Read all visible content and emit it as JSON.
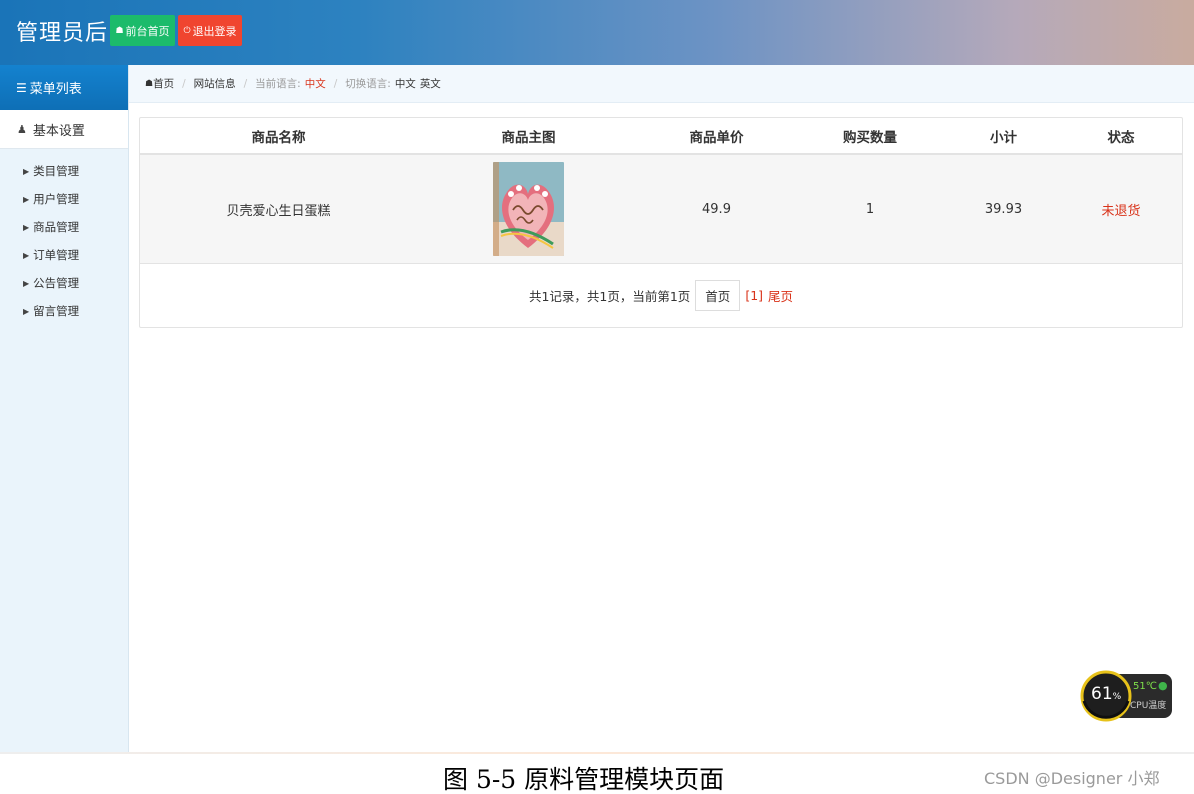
{
  "header": {
    "title": "管理员后台",
    "home_button": "前台首页",
    "logout_button": "退出登录"
  },
  "sidebar": {
    "menu_title": "菜单列表",
    "group_title": "基本设置",
    "items": [
      {
        "label": "类目管理"
      },
      {
        "label": "用户管理"
      },
      {
        "label": "商品管理"
      },
      {
        "label": "订单管理"
      },
      {
        "label": "公告管理"
      },
      {
        "label": "留言管理"
      }
    ]
  },
  "breadcrumb": {
    "home": "首页",
    "site_info": "网站信息",
    "current_lang_label": "当前语言:",
    "current_lang": "中文",
    "switch_lang_label": "切换语言:",
    "lang_zh": "中文",
    "lang_en": "英文"
  },
  "table": {
    "headers": [
      "商品名称",
      "商品主图",
      "商品单价",
      "购买数量",
      "小计",
      "状态"
    ],
    "rows": [
      {
        "name": "贝壳爱心生日蛋糕",
        "price": "49.9",
        "qty": "1",
        "subtotal": "39.93",
        "status": "未退货"
      }
    ]
  },
  "pagination": {
    "summary": "共1记录，共1页，当前第1页",
    "first": "首页",
    "current": "[1]",
    "last": "尾页"
  },
  "cpu": {
    "percent": "61",
    "percent_unit": "%",
    "temp": "51℃",
    "label": "CPU温度"
  },
  "caption": "图 5-5  原料管理模块页面",
  "watermark": "CSDN @Designer 小郑",
  "colors": {
    "primary": "#1482cf",
    "success": "#1cbb6b",
    "danger": "#f0452f",
    "link_red": "#d9331a"
  }
}
